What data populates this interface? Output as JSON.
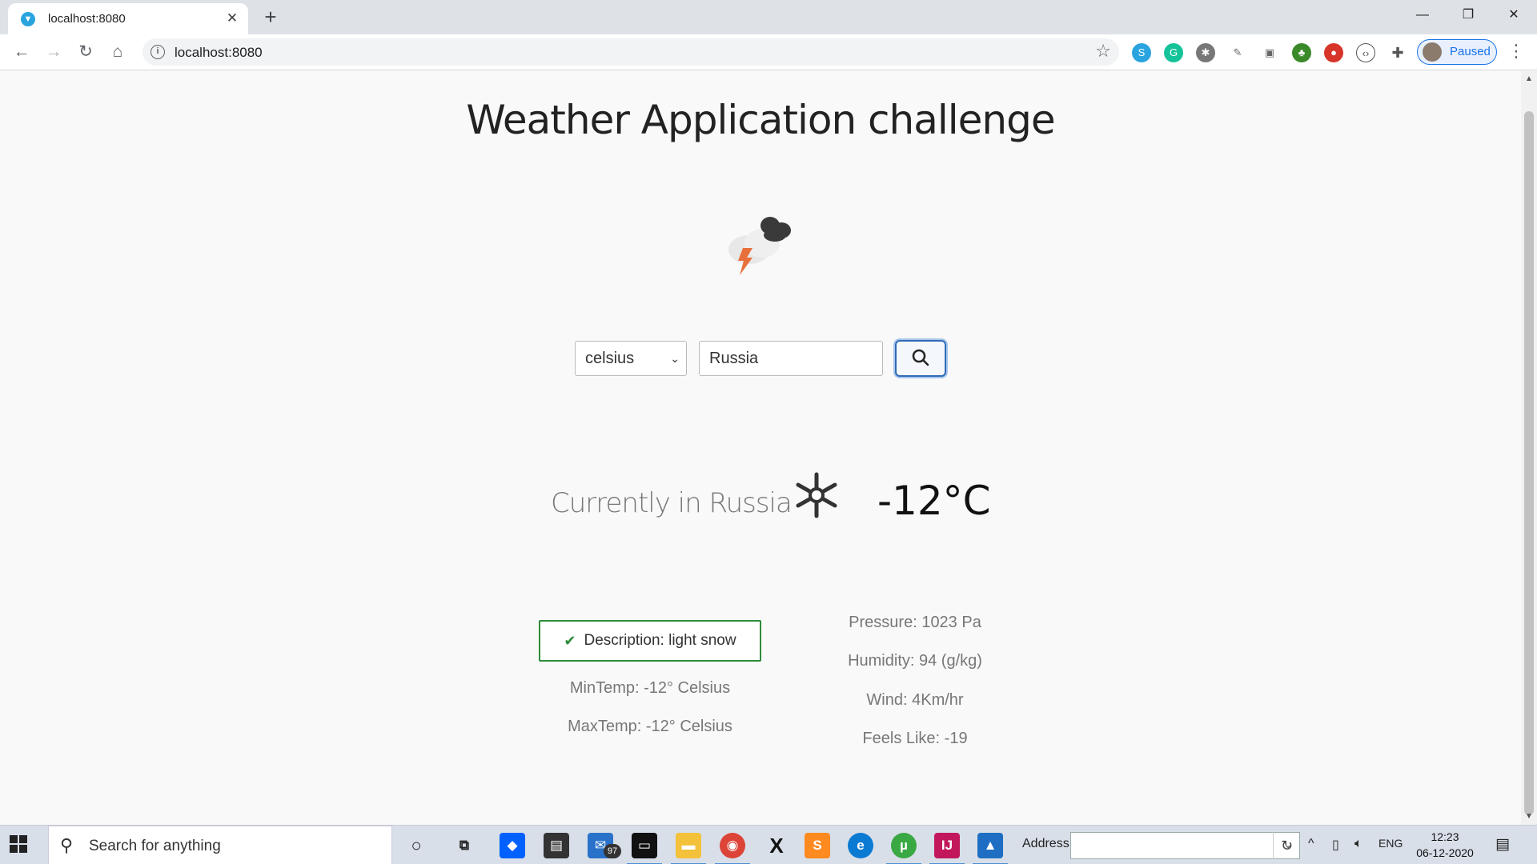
{
  "browser": {
    "tab_title": "localhost:8080",
    "url": "localhost:8080",
    "profile_label": "Paused",
    "window_controls": {
      "minimize": "—",
      "maximize": "❐",
      "close": "✕"
    }
  },
  "page": {
    "title": "Weather Application challenge",
    "unit_select": {
      "selected": "celsius"
    },
    "city_input": {
      "value": "Russia"
    },
    "current_label": "Currently in Russia",
    "temperature": "-12°C",
    "description": "Description: light snow",
    "min_temp": "MinTemp: -12° Celsius",
    "max_temp": "MaxTemp: -12° Celsius",
    "pressure": "Pressure: 1023 Pa",
    "humidity": "Humidity: 94 (g/kg)",
    "wind": "Wind: 4Km/hr",
    "feels_like": "Feels Like: -19"
  },
  "taskbar": {
    "search_placeholder": "Search for anything",
    "mail_badge": "97",
    "address_label": "Address",
    "language": "ENG",
    "time": "12:23",
    "date": "06-12-2020"
  },
  "colors": {
    "accent_blue": "#2f6bb6",
    "success_green": "#2e8b3a",
    "lightning_orange": "#e8703a"
  }
}
